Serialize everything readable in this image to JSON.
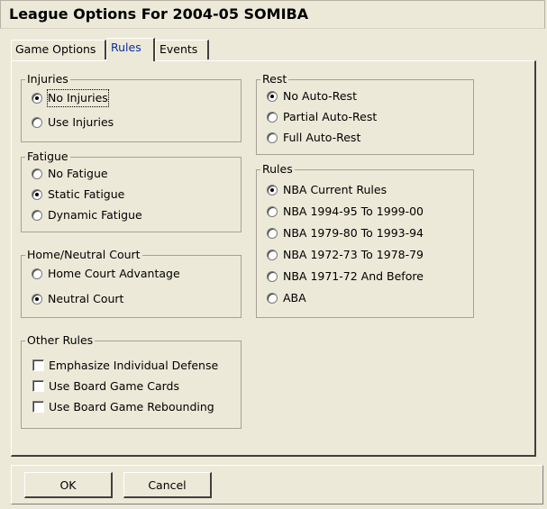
{
  "window": {
    "title": "League Options For 2004-05 SOMIBA"
  },
  "tabs": [
    {
      "label": "Game Options",
      "active": false
    },
    {
      "label": "Rules",
      "active": true
    },
    {
      "label": "Events",
      "active": false
    }
  ],
  "injuries": {
    "title": "Injuries",
    "options": [
      {
        "label": "No Injuries",
        "checked": true
      },
      {
        "label": "Use Injuries",
        "checked": false
      }
    ]
  },
  "fatigue": {
    "title": "Fatigue",
    "options": [
      {
        "label": "No Fatigue",
        "checked": false
      },
      {
        "label": "Static Fatigue",
        "checked": true
      },
      {
        "label": "Dynamic Fatigue",
        "checked": false
      }
    ]
  },
  "court": {
    "title": "Home/Neutral Court",
    "options": [
      {
        "label": "Home Court Advantage",
        "checked": false
      },
      {
        "label": "Neutral Court",
        "checked": true
      }
    ]
  },
  "other_rules": {
    "title": "Other Rules",
    "options": [
      {
        "label": "Emphasize Individual Defense",
        "checked": false
      },
      {
        "label": "Use Board Game Cards",
        "checked": false
      },
      {
        "label": "Use Board Game Rebounding",
        "checked": false
      }
    ]
  },
  "rest": {
    "title": "Rest",
    "options": [
      {
        "label": "No Auto-Rest",
        "checked": true
      },
      {
        "label": "Partial Auto-Rest",
        "checked": false
      },
      {
        "label": "Full Auto-Rest",
        "checked": false
      }
    ]
  },
  "rules": {
    "title": "Rules",
    "options": [
      {
        "label": "NBA Current Rules",
        "checked": true
      },
      {
        "label": "NBA 1994-95 To 1999-00",
        "checked": false
      },
      {
        "label": "NBA 1979-80 To 1993-94",
        "checked": false
      },
      {
        "label": "NBA 1972-73 To 1978-79",
        "checked": false
      },
      {
        "label": "NBA 1971-72 And Before",
        "checked": false
      },
      {
        "label": "ABA",
        "checked": false
      }
    ]
  },
  "buttons": {
    "ok": "OK",
    "cancel": "Cancel"
  }
}
